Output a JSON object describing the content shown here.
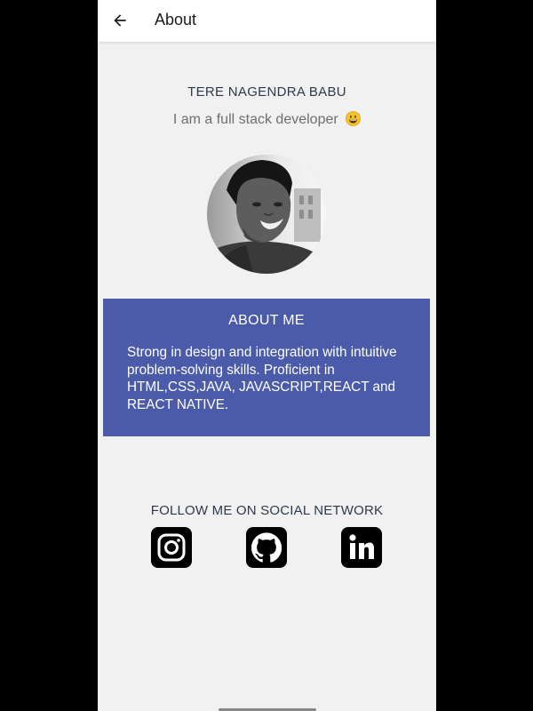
{
  "appbar": {
    "title": "About",
    "back_icon": "arrow-left-icon"
  },
  "profile": {
    "name": "TERE NAGENDRA BABU",
    "tagline": "I am a full stack developer",
    "tagline_emoji": "grinning-face-icon"
  },
  "about": {
    "title": "ABOUT ME",
    "text": "Strong in design and integration with intuitive problem-solving skills. Proficient in HTML,CSS,JAVA, JAVASCRIPT,REACT and REACT NATIVE.",
    "background_color": "#4b5ba9"
  },
  "social": {
    "title": "FOLLOW ME ON SOCIAL NETWORK",
    "links": [
      {
        "icon": "instagram-icon"
      },
      {
        "icon": "github-icon"
      },
      {
        "icon": "linkedin-icon"
      }
    ]
  },
  "colors": {
    "page_background": "#f1f1f1",
    "appbar_background": "#ffffff",
    "heading_text": "#2f3a4a",
    "muted_text": "#6f6f6f"
  }
}
